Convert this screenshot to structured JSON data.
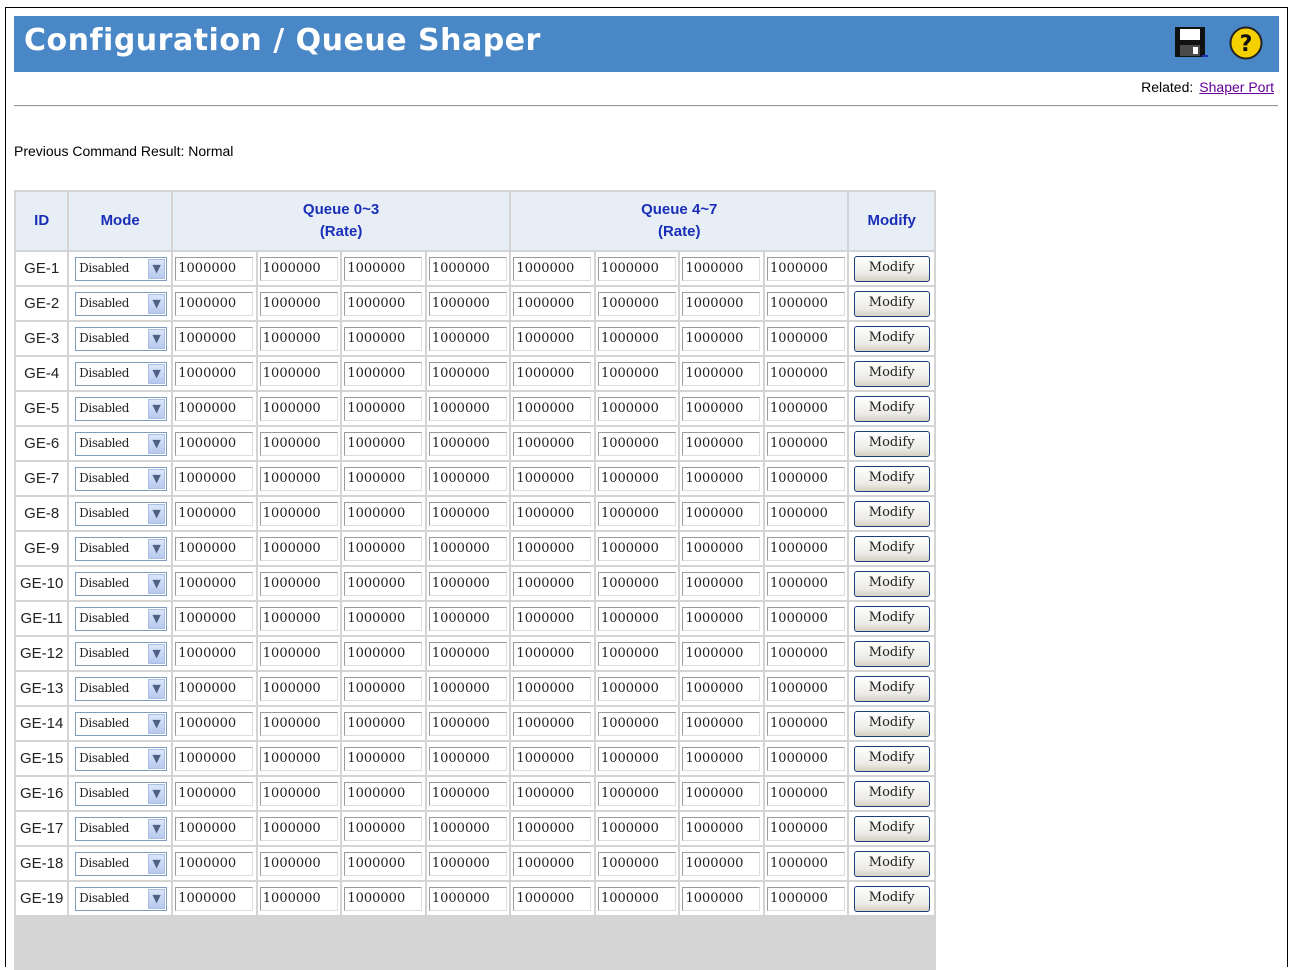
{
  "page": {
    "title": "Configuration / Queue Shaper",
    "related_label": "Related:",
    "related_link": "Shaper Port",
    "result_text": "Previous Command Result: Normal"
  },
  "icons": {
    "save": "save-icon",
    "help": "help-icon"
  },
  "colors": {
    "title_bar": "#4a87c6",
    "header_text": "#1a2fb8",
    "link": "#660099"
  },
  "table": {
    "headers": {
      "id": "ID",
      "mode": "Mode",
      "queue03_line1": "Queue 0~3",
      "queue03_line2": "(Rate)",
      "queue47_line1": "Queue 4~7",
      "queue47_line2": "(Rate)",
      "modify": "Modify"
    },
    "rows": [
      {
        "id": "GE-1",
        "mode": "Disabled",
        "rates": [
          "1000000",
          "1000000",
          "1000000",
          "1000000",
          "1000000",
          "1000000",
          "1000000",
          "1000000"
        ],
        "button": "Modify"
      },
      {
        "id": "GE-2",
        "mode": "Disabled",
        "rates": [
          "1000000",
          "1000000",
          "1000000",
          "1000000",
          "1000000",
          "1000000",
          "1000000",
          "1000000"
        ],
        "button": "Modify"
      },
      {
        "id": "GE-3",
        "mode": "Disabled",
        "rates": [
          "1000000",
          "1000000",
          "1000000",
          "1000000",
          "1000000",
          "1000000",
          "1000000",
          "1000000"
        ],
        "button": "Modify"
      },
      {
        "id": "GE-4",
        "mode": "Disabled",
        "rates": [
          "1000000",
          "1000000",
          "1000000",
          "1000000",
          "1000000",
          "1000000",
          "1000000",
          "1000000"
        ],
        "button": "Modify"
      },
      {
        "id": "GE-5",
        "mode": "Disabled",
        "rates": [
          "1000000",
          "1000000",
          "1000000",
          "1000000",
          "1000000",
          "1000000",
          "1000000",
          "1000000"
        ],
        "button": "Modify"
      },
      {
        "id": "GE-6",
        "mode": "Disabled",
        "rates": [
          "1000000",
          "1000000",
          "1000000",
          "1000000",
          "1000000",
          "1000000",
          "1000000",
          "1000000"
        ],
        "button": "Modify"
      },
      {
        "id": "GE-7",
        "mode": "Disabled",
        "rates": [
          "1000000",
          "1000000",
          "1000000",
          "1000000",
          "1000000",
          "1000000",
          "1000000",
          "1000000"
        ],
        "button": "Modify"
      },
      {
        "id": "GE-8",
        "mode": "Disabled",
        "rates": [
          "1000000",
          "1000000",
          "1000000",
          "1000000",
          "1000000",
          "1000000",
          "1000000",
          "1000000"
        ],
        "button": "Modify"
      },
      {
        "id": "GE-9",
        "mode": "Disabled",
        "rates": [
          "1000000",
          "1000000",
          "1000000",
          "1000000",
          "1000000",
          "1000000",
          "1000000",
          "1000000"
        ],
        "button": "Modify"
      },
      {
        "id": "GE-10",
        "mode": "Disabled",
        "rates": [
          "1000000",
          "1000000",
          "1000000",
          "1000000",
          "1000000",
          "1000000",
          "1000000",
          "1000000"
        ],
        "button": "Modify"
      },
      {
        "id": "GE-11",
        "mode": "Disabled",
        "rates": [
          "1000000",
          "1000000",
          "1000000",
          "1000000",
          "1000000",
          "1000000",
          "1000000",
          "1000000"
        ],
        "button": "Modify"
      },
      {
        "id": "GE-12",
        "mode": "Disabled",
        "rates": [
          "1000000",
          "1000000",
          "1000000",
          "1000000",
          "1000000",
          "1000000",
          "1000000",
          "1000000"
        ],
        "button": "Modify"
      },
      {
        "id": "GE-13",
        "mode": "Disabled",
        "rates": [
          "1000000",
          "1000000",
          "1000000",
          "1000000",
          "1000000",
          "1000000",
          "1000000",
          "1000000"
        ],
        "button": "Modify"
      },
      {
        "id": "GE-14",
        "mode": "Disabled",
        "rates": [
          "1000000",
          "1000000",
          "1000000",
          "1000000",
          "1000000",
          "1000000",
          "1000000",
          "1000000"
        ],
        "button": "Modify"
      },
      {
        "id": "GE-15",
        "mode": "Disabled",
        "rates": [
          "1000000",
          "1000000",
          "1000000",
          "1000000",
          "1000000",
          "1000000",
          "1000000",
          "1000000"
        ],
        "button": "Modify"
      },
      {
        "id": "GE-16",
        "mode": "Disabled",
        "rates": [
          "1000000",
          "1000000",
          "1000000",
          "1000000",
          "1000000",
          "1000000",
          "1000000",
          "1000000"
        ],
        "button": "Modify"
      },
      {
        "id": "GE-17",
        "mode": "Disabled",
        "rates": [
          "1000000",
          "1000000",
          "1000000",
          "1000000",
          "1000000",
          "1000000",
          "1000000",
          "1000000"
        ],
        "button": "Modify"
      },
      {
        "id": "GE-18",
        "mode": "Disabled",
        "rates": [
          "1000000",
          "1000000",
          "1000000",
          "1000000",
          "1000000",
          "1000000",
          "1000000",
          "1000000"
        ],
        "button": "Modify"
      },
      {
        "id": "GE-19",
        "mode": "Disabled",
        "rates": [
          "1000000",
          "1000000",
          "1000000",
          "1000000",
          "1000000",
          "1000000",
          "1000000",
          "1000000"
        ],
        "button": "Modify"
      }
    ]
  }
}
